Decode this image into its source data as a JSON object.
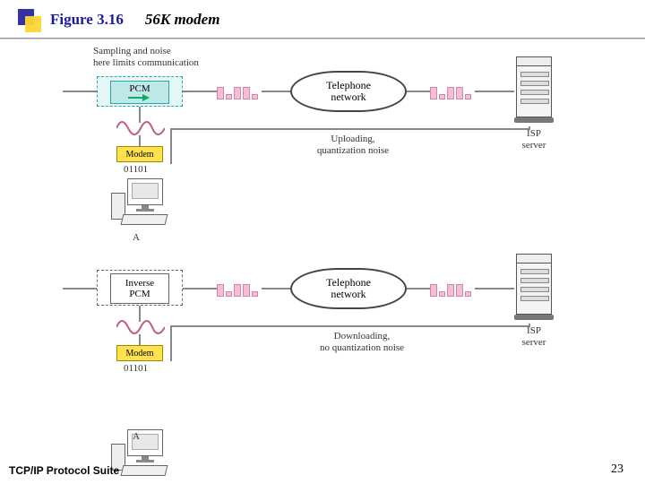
{
  "header": {
    "figure_label": "Figure 3.16",
    "figure_title": "56K modem"
  },
  "annotations": {
    "sampling_note_l1": "Sampling and noise",
    "sampling_note_l2": "here limits communication",
    "uploading_l1": "Uploading,",
    "uploading_l2": "quantization noise",
    "downloading_l1": "Downloading,",
    "downloading_l2": "no quantization noise",
    "bits_label": "01101",
    "host_a": "A",
    "isp_l1": "ISP",
    "isp_l2": "server"
  },
  "blocks": {
    "pcm": "PCM",
    "inverse_pcm_l1": "Inverse",
    "inverse_pcm_l2": "PCM",
    "modem": "Modem",
    "tel_net_l1": "Telephone",
    "tel_net_l2": "network"
  },
  "footer": {
    "left": "TCP/IP Protocol Suite",
    "page": "23"
  }
}
